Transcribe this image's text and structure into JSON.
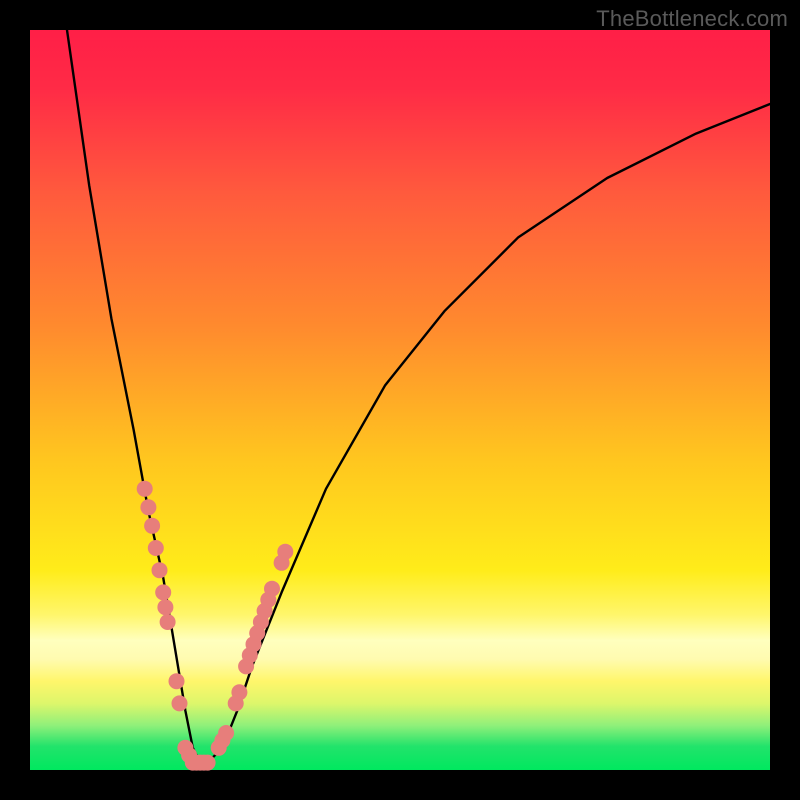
{
  "watermark": "TheBottleneck.com",
  "chart_data": {
    "type": "line",
    "title": "",
    "xlabel": "",
    "ylabel": "",
    "xlim": [
      0,
      100
    ],
    "ylim": [
      0,
      100
    ],
    "annotations": [],
    "series": [
      {
        "name": "bottleneck-curve",
        "x": [
          5,
          8,
          11,
          14,
          16,
          18,
          19,
          20,
          21,
          22,
          23,
          24,
          26,
          28,
          30,
          34,
          40,
          48,
          56,
          66,
          78,
          90,
          100
        ],
        "values": [
          100,
          79,
          61,
          46,
          35,
          26,
          20,
          14,
          8,
          3,
          1,
          1,
          3,
          8,
          14,
          24,
          38,
          52,
          62,
          72,
          80,
          86,
          90
        ]
      }
    ],
    "markers": {
      "name": "highlight-dots",
      "color": "#e77e7b",
      "points_x": [
        15.5,
        16.0,
        16.5,
        17.0,
        17.5,
        18.0,
        18.3,
        18.6,
        19.8,
        20.2,
        21.0,
        21.5,
        22.0,
        22.5,
        23.0,
        23.5,
        24.0,
        25.5,
        26.0,
        26.5,
        27.8,
        28.3,
        29.2,
        29.7,
        30.2,
        30.7,
        31.2,
        31.7,
        32.2,
        32.7,
        34.0,
        34.5
      ],
      "points_values": [
        38,
        35.5,
        33,
        30,
        27,
        24,
        22,
        20,
        12,
        9,
        3,
        2,
        1,
        1,
        1,
        1,
        1,
        3,
        4,
        5,
        9,
        10.5,
        14,
        15.5,
        17,
        18.5,
        20,
        21.5,
        23,
        24.5,
        28,
        29.5
      ]
    },
    "background": {
      "type": "vertical-gradient",
      "stops": [
        {
          "pos": 0.0,
          "color": "#ff1f47"
        },
        {
          "pos": 0.4,
          "color": "#ff8a2e"
        },
        {
          "pos": 0.73,
          "color": "#ffec1a"
        },
        {
          "pos": 0.83,
          "color": "#ffffbe"
        },
        {
          "pos": 0.97,
          "color": "#22e36b"
        },
        {
          "pos": 1.0,
          "color": "#00e85f"
        }
      ]
    }
  }
}
